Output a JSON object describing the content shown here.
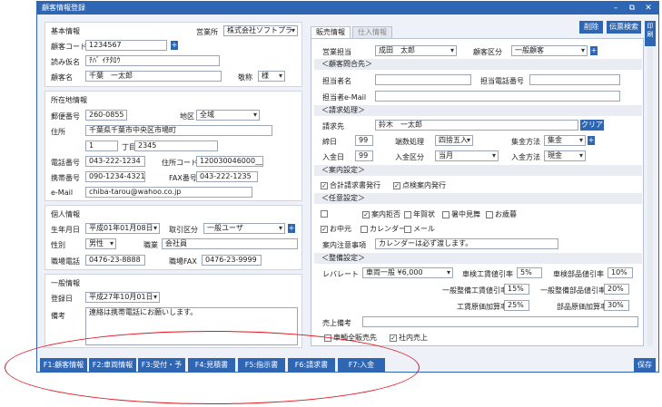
{
  "window": {
    "title": "顧客情報登録"
  },
  "left": {
    "basic": {
      "title": "基本情報",
      "office_label": "営業所",
      "office_value": "株式会社ソフトプラ",
      "code_label": "顧客コード",
      "code_value": "1234567",
      "kana_label": "読み仮名",
      "kana_value": "ﾁﾊﾞ ｲﾁﾀﾛｳ",
      "name_label": "顧客名",
      "name_value": "千葉　一太郎",
      "honorific_label": "敬称",
      "honorific_value": "様"
    },
    "address": {
      "title": "所在地情報",
      "zip_label": "郵便番号",
      "zip_value": "260-0855",
      "region_label": "地区",
      "region_value": "全域",
      "addr_label": "住所",
      "addr_value": "千葉県千葉市中央区市場町",
      "addr2_value": "1",
      "chome_label": "丁目",
      "addr3_value": "2345",
      "tel_label": "電話番号",
      "tel_value": "043-222-1234",
      "addrcode_label": "住所コード",
      "addrcode_value": "120030046000___",
      "mobile_label": "携帯番号",
      "mobile_value": "090-1234-4321",
      "fax_label": "FAX番号",
      "fax_value": "043-222-1235",
      "email_label": "e-Mail",
      "email_value": "chiba-tarou@wahoo.co.jp"
    },
    "personal": {
      "title": "個人情報",
      "birth_label": "生年月日",
      "birth_value": "平成01年01月08日",
      "deal_label": "取引区分",
      "deal_value": "一般ユーザ",
      "gender_label": "性別",
      "gender_value": "男性",
      "job_label": "職業",
      "job_value": "会社員",
      "worktel_label": "職場電話",
      "worktel_value": "0476-23-8888",
      "workfax_label": "職場FAX",
      "workfax_value": "0476-23-9999"
    },
    "general": {
      "title": "一般情報",
      "regdate_label": "登録日",
      "regdate_value": "平成27年10月01日",
      "note_label": "備考",
      "note_value": "連絡は携帯電話にお願いします。"
    }
  },
  "top_buttons": {
    "delete": "削除",
    "slip_search": "伝票検索",
    "print": "印刷"
  },
  "tabs": {
    "sales": "販売情報",
    "purchase": "仕入情報"
  },
  "sales": {
    "rep_label": "営業担当",
    "rep_value": "成田　太郎",
    "ctype_label": "顧客区分",
    "ctype_value": "一般顧客",
    "contact_section": "＜顧客問合先＞",
    "contact_name_label": "担当者名",
    "contact_tel_label": "担当電話番号",
    "contact_mail_label": "担当者e-Mail",
    "billing_section": "＜請求処理＞",
    "billto_label": "請求先",
    "billto_value": "鈴木　一太郎",
    "clear_label": "クリア",
    "cutoff_label": "締日",
    "cutoff_value": "99",
    "rounding_label": "端数処理",
    "rounding_value": "四捨五入",
    "collect_label": "集金方法",
    "collect_value": "集金",
    "payday_label": "入金日",
    "payday_value": "99",
    "paytype_label": "入金区分",
    "paytype_value": "当月",
    "paymethod_label": "入金方法",
    "paymethod_value": "現金",
    "notice_section": "＜案内設定＞",
    "chk_total_invoice": "合計請求書発行",
    "chk_inspection": "点検案内発行",
    "optional_section": "＜任意設定＞",
    "chk_refuse": "案内拒否",
    "chk_newyear": "年賀状",
    "chk_summer": "暑中見舞",
    "chk_winter": "お歳暮",
    "chk_midsummer": "お中元",
    "chk_calendar": "カレンダー",
    "chk_mail": "メール",
    "caution_label": "案内注意事項",
    "caution_value": "カレンダーは必ず渡します。",
    "maint_section": "＜整備設定＞",
    "level_label": "レバレート",
    "level_value": "車両一般 ¥6,000",
    "inspect_labor_label": "車検工賃値引率",
    "inspect_labor_value": "5%",
    "inspect_parts_label": "車検部品値引率",
    "inspect_parts_value": "10%",
    "maint_labor_label": "一般整備工賃値引率",
    "maint_labor_value": "15%",
    "maint_parts_label": "一般整備部品値引率",
    "maint_parts_value": "20%",
    "labor_markup_label": "工賃原価加算率",
    "labor_markup_value": "25%",
    "parts_markup_label": "部品原価加算率",
    "parts_markup_value": "30%",
    "sales_note_label": "売上備考",
    "chk_vehicle_only": "車輌全販売先",
    "chk_internal": "社内売上"
  },
  "function_keys": [
    "F1:顧客情報",
    "F2:車両情報",
    "F3:受付・予約",
    "F4:見積書",
    "F5:指示書",
    "F6:請求書",
    "F7:入金"
  ],
  "save_label": "保存",
  "colors": {
    "accent": "#2f66b3",
    "highlight": "#e3111b"
  }
}
